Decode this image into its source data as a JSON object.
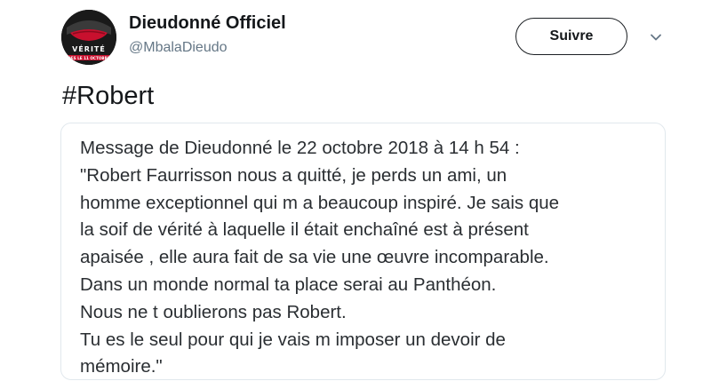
{
  "tweet": {
    "author": {
      "display_name": "Dieudonné Officiel",
      "handle": "@MbalaDieudo",
      "avatar_text": "VÉRITÉ",
      "avatar_subtext": "DES LE 11 OCTOBRE"
    },
    "follow_label": "Suivre",
    "hashtag": "#Robert",
    "quote": {
      "lines": [
        "Message de Dieudonné le 22 octobre 2018 à 14 h 54 :",
        "\"Robert Faurrisson nous a quitté, je perds un ami, un",
        "homme exceptionnel qui m a beaucoup inspiré. Je sais que",
        "la soif de vérité à laquelle il était enchaîné est à présent",
        "apaisée , elle aura fait de sa vie une œuvre incomparable.",
        "Dans un monde normal ta place serai au Panthéon.",
        "Nous ne t oublierons pas Robert.",
        "Tu es le seul pour qui je vais m imposer un devoir de",
        "mémoire.\""
      ]
    },
    "icons": {
      "more": "chevron-down-icon"
    },
    "colors": {
      "text": "#14171a",
      "secondary_text": "#657786",
      "card_border": "#e1e8ed",
      "avatar_accent": "#c8102e"
    }
  }
}
